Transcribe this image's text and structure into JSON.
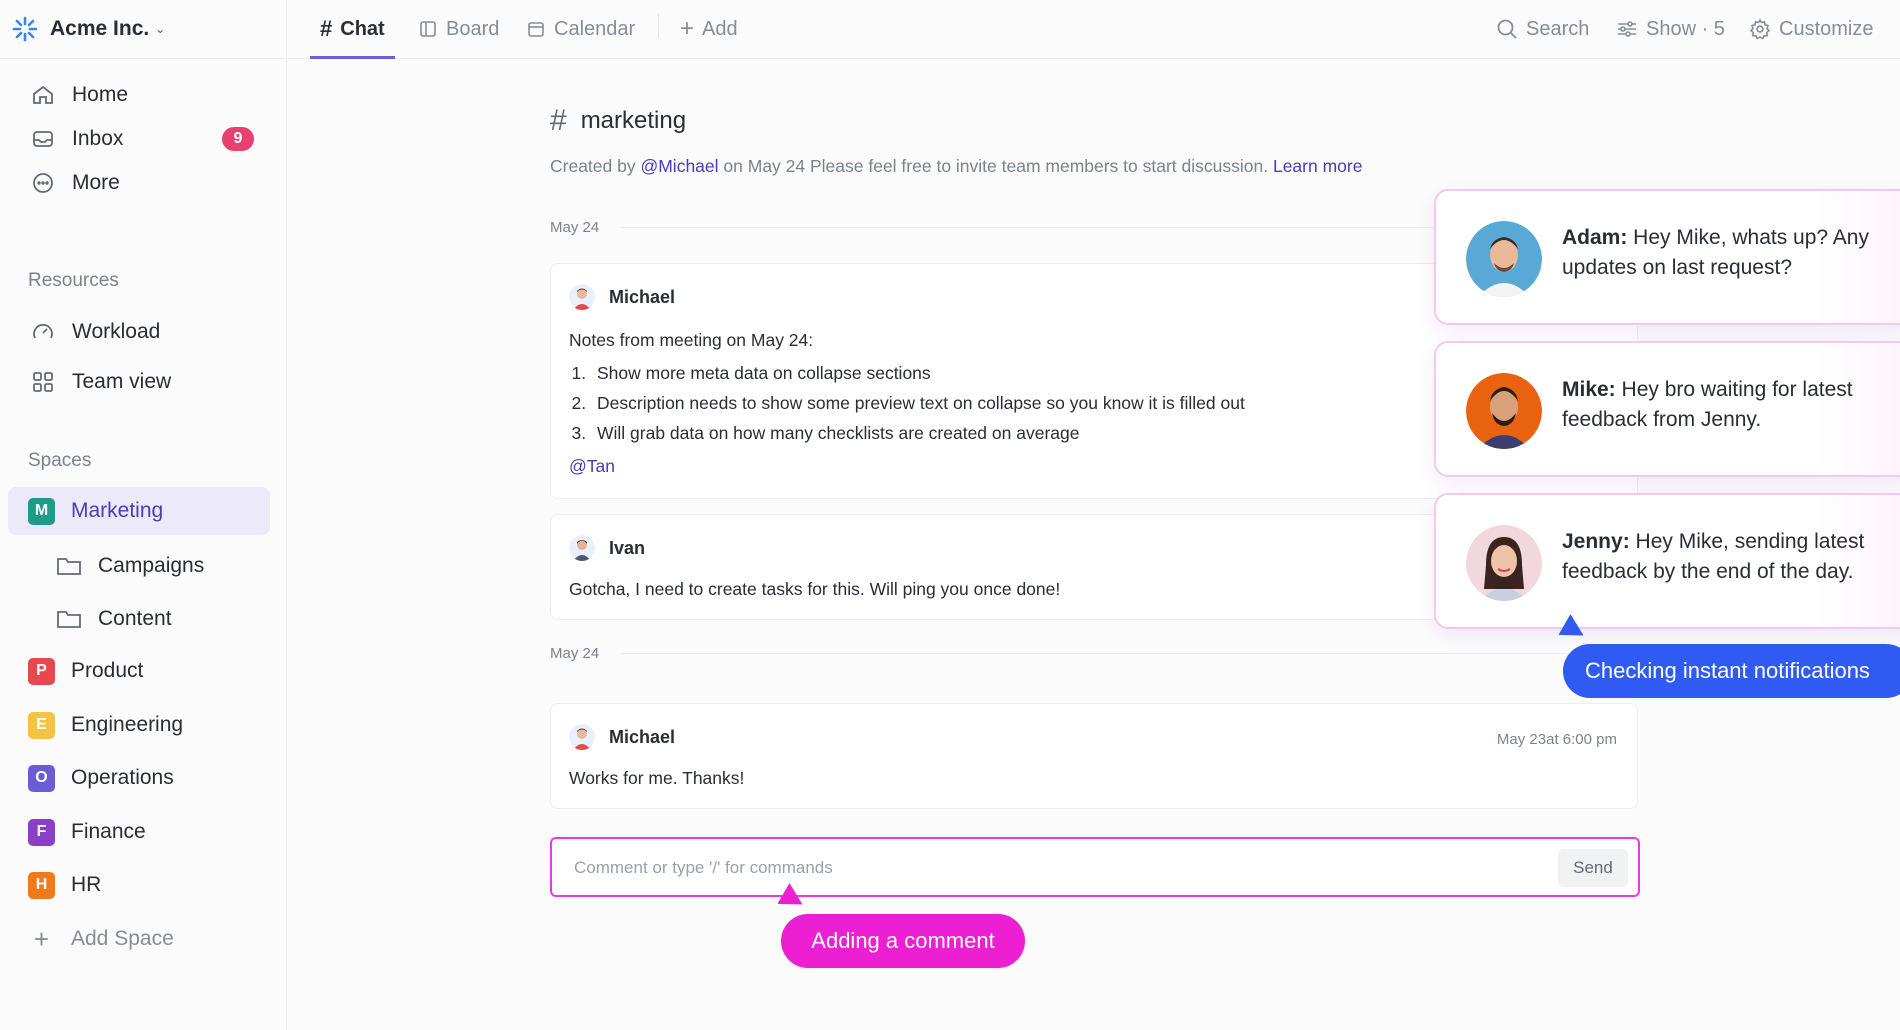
{
  "brand": {
    "name": "Acme Inc."
  },
  "nav": [
    {
      "label": "Home",
      "icon": "home-icon"
    },
    {
      "label": "Inbox",
      "icon": "inbox-icon",
      "badge": "9"
    },
    {
      "label": "More",
      "icon": "more-icon"
    }
  ],
  "resources": {
    "label": "Resources",
    "items": [
      {
        "label": "Workload",
        "icon": "gauge-icon"
      },
      {
        "label": "Team view",
        "icon": "grid-icon"
      }
    ]
  },
  "spaces": {
    "label": "Spaces",
    "items": [
      {
        "label": "Marketing",
        "letter": "M",
        "color": "#1f9b8a",
        "active": true
      },
      {
        "label": "Campaigns",
        "folder": true
      },
      {
        "label": "Content",
        "folder": true
      },
      {
        "label": "Product",
        "letter": "P",
        "color": "#e5484d"
      },
      {
        "label": "Engineering",
        "letter": "E",
        "color": "#f5c344"
      },
      {
        "label": "Operations",
        "letter": "O",
        "color": "#6b5bd6"
      },
      {
        "label": "Finance",
        "letter": "F",
        "color": "#8a3fc8"
      },
      {
        "label": "HR",
        "letter": "H",
        "color": "#f07a1a"
      }
    ],
    "add_label": "Add Space"
  },
  "tabs": [
    {
      "label": "Chat",
      "icon": "hash-icon",
      "active": true
    },
    {
      "label": "Board",
      "icon": "board-icon"
    },
    {
      "label": "Calendar",
      "icon": "calendar-icon"
    },
    {
      "label": "Add",
      "icon": "plus-icon"
    }
  ],
  "toolbar": {
    "search": "Search",
    "show": "Show · 5",
    "customize": "Customize"
  },
  "channel": {
    "name": "marketing",
    "desc_prefix": "Created by ",
    "desc_mention": "@Michael",
    "desc_middle": " on May 24  Please feel free to invite team members to start discussion. ",
    "desc_link": "Learn more"
  },
  "dates": [
    "May 24",
    "May 24"
  ],
  "messages": [
    {
      "author": "Michael",
      "intro": "Notes from meeting on May 24:",
      "list": [
        "Show more meta data on collapse sections",
        "Description needs to show some preview text on collapse so you know it is filled out",
        "Will grab data on how many checklists are created on average"
      ],
      "tag": "@Tan"
    },
    {
      "author": "Ivan",
      "text": "Gotcha, I need to create tasks for this. Will ping you once done!"
    },
    {
      "author": "Michael",
      "text": "Works for me. Thanks!",
      "time": "May 23at 6:00 pm"
    }
  ],
  "composer": {
    "placeholder": "Comment or type '/' for commands",
    "send": "Send"
  },
  "notifications": [
    {
      "name": "Adam:",
      "text": " Hey Mike, whats up? Any updates on last request?"
    },
    {
      "name": "Mike:",
      "text": " Hey bro waiting for latest feedback from Jenny."
    },
    {
      "name": "Jenny:",
      "text": " Hey Mike, sending latest feedback by the end of the day."
    }
  ],
  "callouts": {
    "comment": "Adding a comment",
    "notifications": "Checking instant notifications"
  }
}
